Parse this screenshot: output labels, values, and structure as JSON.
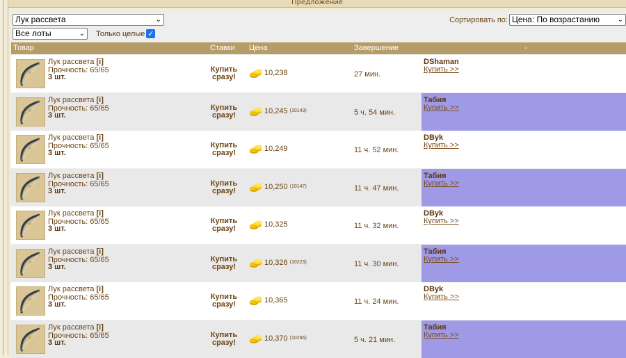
{
  "header": {
    "title": "Предложение"
  },
  "controls": {
    "item_select": "Лук рассвета",
    "lots_select": "Все лоты",
    "only_whole_label": "Только целые",
    "only_whole_checked": true,
    "sort_label": "Сортировать по:",
    "sort_select": "Цена: По возрастанию"
  },
  "columns": {
    "item": "Товар",
    "bids": "Ставки",
    "price": "Цена",
    "ending": "Завершение",
    "seller": "-"
  },
  "rows": [
    {
      "name": "Лук рассвета",
      "info": "[i]",
      "durability": "Прочность: 65/65",
      "qty": "3 шт.",
      "buy": "Купить сразу!",
      "price": "10,238",
      "per_unit": "",
      "ending": "27 мин.",
      "seller": "DShaman",
      "buy_link": "Купить >>",
      "highlight": false
    },
    {
      "name": "Лук рассвета",
      "info": "[i]",
      "durability": "Прочность: 65/65",
      "qty": "3 шт.",
      "buy": "Купить сразу!",
      "price": "10,245",
      "per_unit": "(10143)",
      "ending": "5 ч. 54 мин.",
      "seller": "Табия",
      "buy_link": "Купить >>",
      "highlight": true
    },
    {
      "name": "Лук рассвета",
      "info": "[i]",
      "durability": "Прочность: 65/65",
      "qty": "3 шт.",
      "buy": "Купить сразу!",
      "price": "10,249",
      "per_unit": "",
      "ending": "11 ч. 52 мин.",
      "seller": "DByk",
      "buy_link": "Купить >>",
      "highlight": false
    },
    {
      "name": "Лук рассвета",
      "info": "[i]",
      "durability": "Прочность: 65/65",
      "qty": "3 шт.",
      "buy": "Купить сразу!",
      "price": "10,250",
      "per_unit": "(10147)",
      "ending": "11 ч. 47 мин.",
      "seller": "Табия",
      "buy_link": "Купить >>",
      "highlight": true
    },
    {
      "name": "Лук рассвета",
      "info": "[i]",
      "durability": "Прочность: 65/65",
      "qty": "3 шт.",
      "buy": "Купить сразу!",
      "price": "10,325",
      "per_unit": "",
      "ending": "11 ч. 32 мин.",
      "seller": "DByk",
      "buy_link": "Купить >>",
      "highlight": false
    },
    {
      "name": "Лук рассвета",
      "info": "[i]",
      "durability": "Прочность: 65/65",
      "qty": "3 шт.",
      "buy": "Купить сразу!",
      "price": "10,326",
      "per_unit": "(10223)",
      "ending": "11 ч. 30 мин.",
      "seller": "Табия",
      "buy_link": "Купить >>",
      "highlight": true
    },
    {
      "name": "Лук рассвета",
      "info": "[i]",
      "durability": "Прочность: 65/65",
      "qty": "3 шт.",
      "buy": "Купить сразу!",
      "price": "10,365",
      "per_unit": "",
      "ending": "11 ч. 24 мин.",
      "seller": "DByk",
      "buy_link": "Купить >>",
      "highlight": false
    },
    {
      "name": "Лук рассвета",
      "info": "[i]",
      "durability": "Прочность: 65/65",
      "qty": "3 шт.",
      "buy": "Купить сразу!",
      "price": "10,370",
      "per_unit": "(10266)",
      "ending": "5 ч. 21 мин.",
      "seller": "Табия",
      "buy_link": "Купить >>",
      "highlight": true
    }
  ],
  "colors": {
    "header_bar": "#b69d67",
    "seller_highlight": "#9f9ae5",
    "text": "#6b4415"
  },
  "icons": {
    "item": "bow-icon",
    "price": "gold-coins-icon",
    "dropdown": "chevron-down-icon",
    "checkbox": "checkmark-icon"
  }
}
